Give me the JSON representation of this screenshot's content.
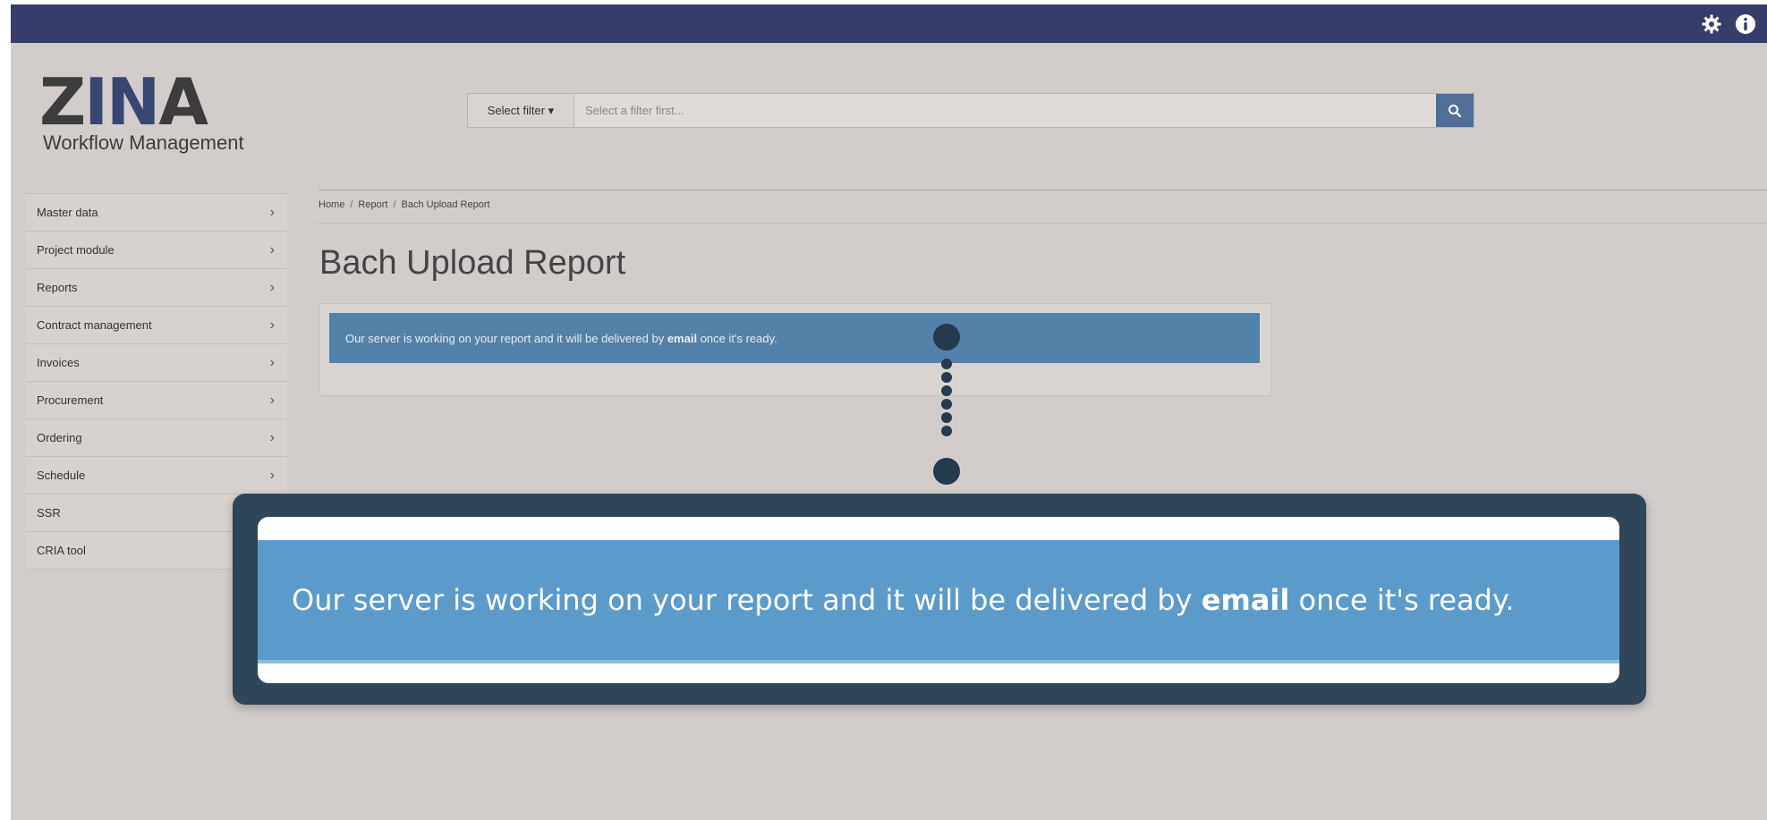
{
  "topbar": {
    "settings_icon": "gear-icon",
    "info_icon": "info-icon",
    "color": "#373d6a"
  },
  "logo": {
    "mark": "ZINA",
    "mark_left": "Z",
    "mark_accent": "IN",
    "mark_right": "A",
    "subtitle": "Workflow Management"
  },
  "search": {
    "filter_label": "Select filter ▾",
    "placeholder": "Select a filter first...",
    "button_icon": "search-icon"
  },
  "sidebar": {
    "items": [
      {
        "label": "Master data",
        "chevron": "›"
      },
      {
        "label": "Project module",
        "chevron": "›"
      },
      {
        "label": "Reports",
        "chevron": "›"
      },
      {
        "label": "Contract management",
        "chevron": "›"
      },
      {
        "label": "Invoices",
        "chevron": "›"
      },
      {
        "label": "Procurement",
        "chevron": "›"
      },
      {
        "label": "Ordering",
        "chevron": "›"
      },
      {
        "label": "Schedule",
        "chevron": "›"
      },
      {
        "label": "SSR",
        "chevron": ""
      },
      {
        "label": "CRIA tool",
        "chevron": ""
      }
    ]
  },
  "breadcrumb": {
    "items": [
      "Home",
      "Report",
      "Bach Upload Report"
    ],
    "separator": "/"
  },
  "page": {
    "title": "Bach Upload Report"
  },
  "alert": {
    "text_before": "Our server is working on your report and it will be delivered by ",
    "emphasis": "email",
    "text_after": " once it's ready.",
    "color": "#5282a9"
  },
  "callout": {
    "text_before": "Our server is working on your report and it will be delivered by ",
    "emphasis": "email",
    "text_after": " once it's ready.",
    "color": "#5a9bcc"
  }
}
